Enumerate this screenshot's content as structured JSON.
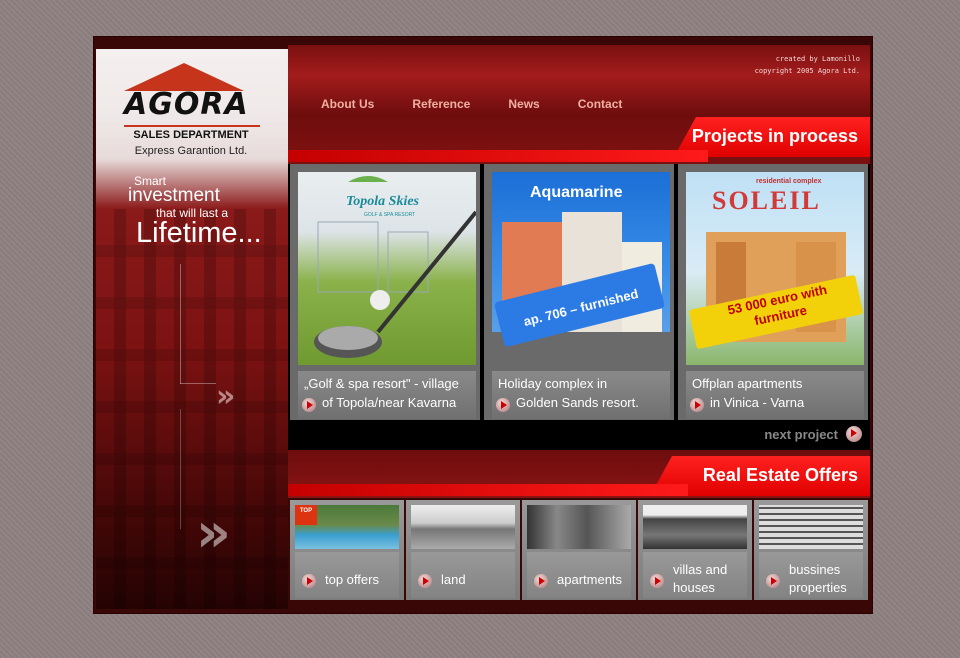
{
  "brand": {
    "logo": "AGORA",
    "sales": "SALES DEPARTMENT",
    "sub": "Express Garantion Ltd."
  },
  "slogan": [
    "Smart",
    "investment",
    "that will last a",
    "Lifetime..."
  ],
  "credits": [
    "created by Lamonillo",
    "copyright 2005 Agora Ltd."
  ],
  "nav": [
    "About Us",
    "Reference",
    "News",
    "Contact"
  ],
  "projects": {
    "title": "Projects in process",
    "items": [
      {
        "line1": "„Golf & spa resort\" - village",
        "line2": "of Topola/near Kavarna",
        "img_text": "Topola Skies",
        "img_sub": "GOLF & SPA RESORT"
      },
      {
        "line1": "Holiday complex in",
        "line2": "Golden Sands resort.",
        "img_text": "Aquamarine",
        "badge": "ap. 706 – furnished"
      },
      {
        "line1": "Offplan apartments",
        "line2": "in Vinica - Varna",
        "img_text": "SOLEIL",
        "img_sub": "residential complex",
        "badge": "53 000 euro with furniture"
      }
    ],
    "next": "next project"
  },
  "offers": {
    "title": "Real Estate Offers",
    "items": [
      {
        "line1": "top offers",
        "tag": "TOP"
      },
      {
        "line1": "land"
      },
      {
        "line1": "apartments"
      },
      {
        "line1": "villas and",
        "line2": "houses"
      },
      {
        "line1": "bussines",
        "line2": "properties"
      }
    ]
  }
}
